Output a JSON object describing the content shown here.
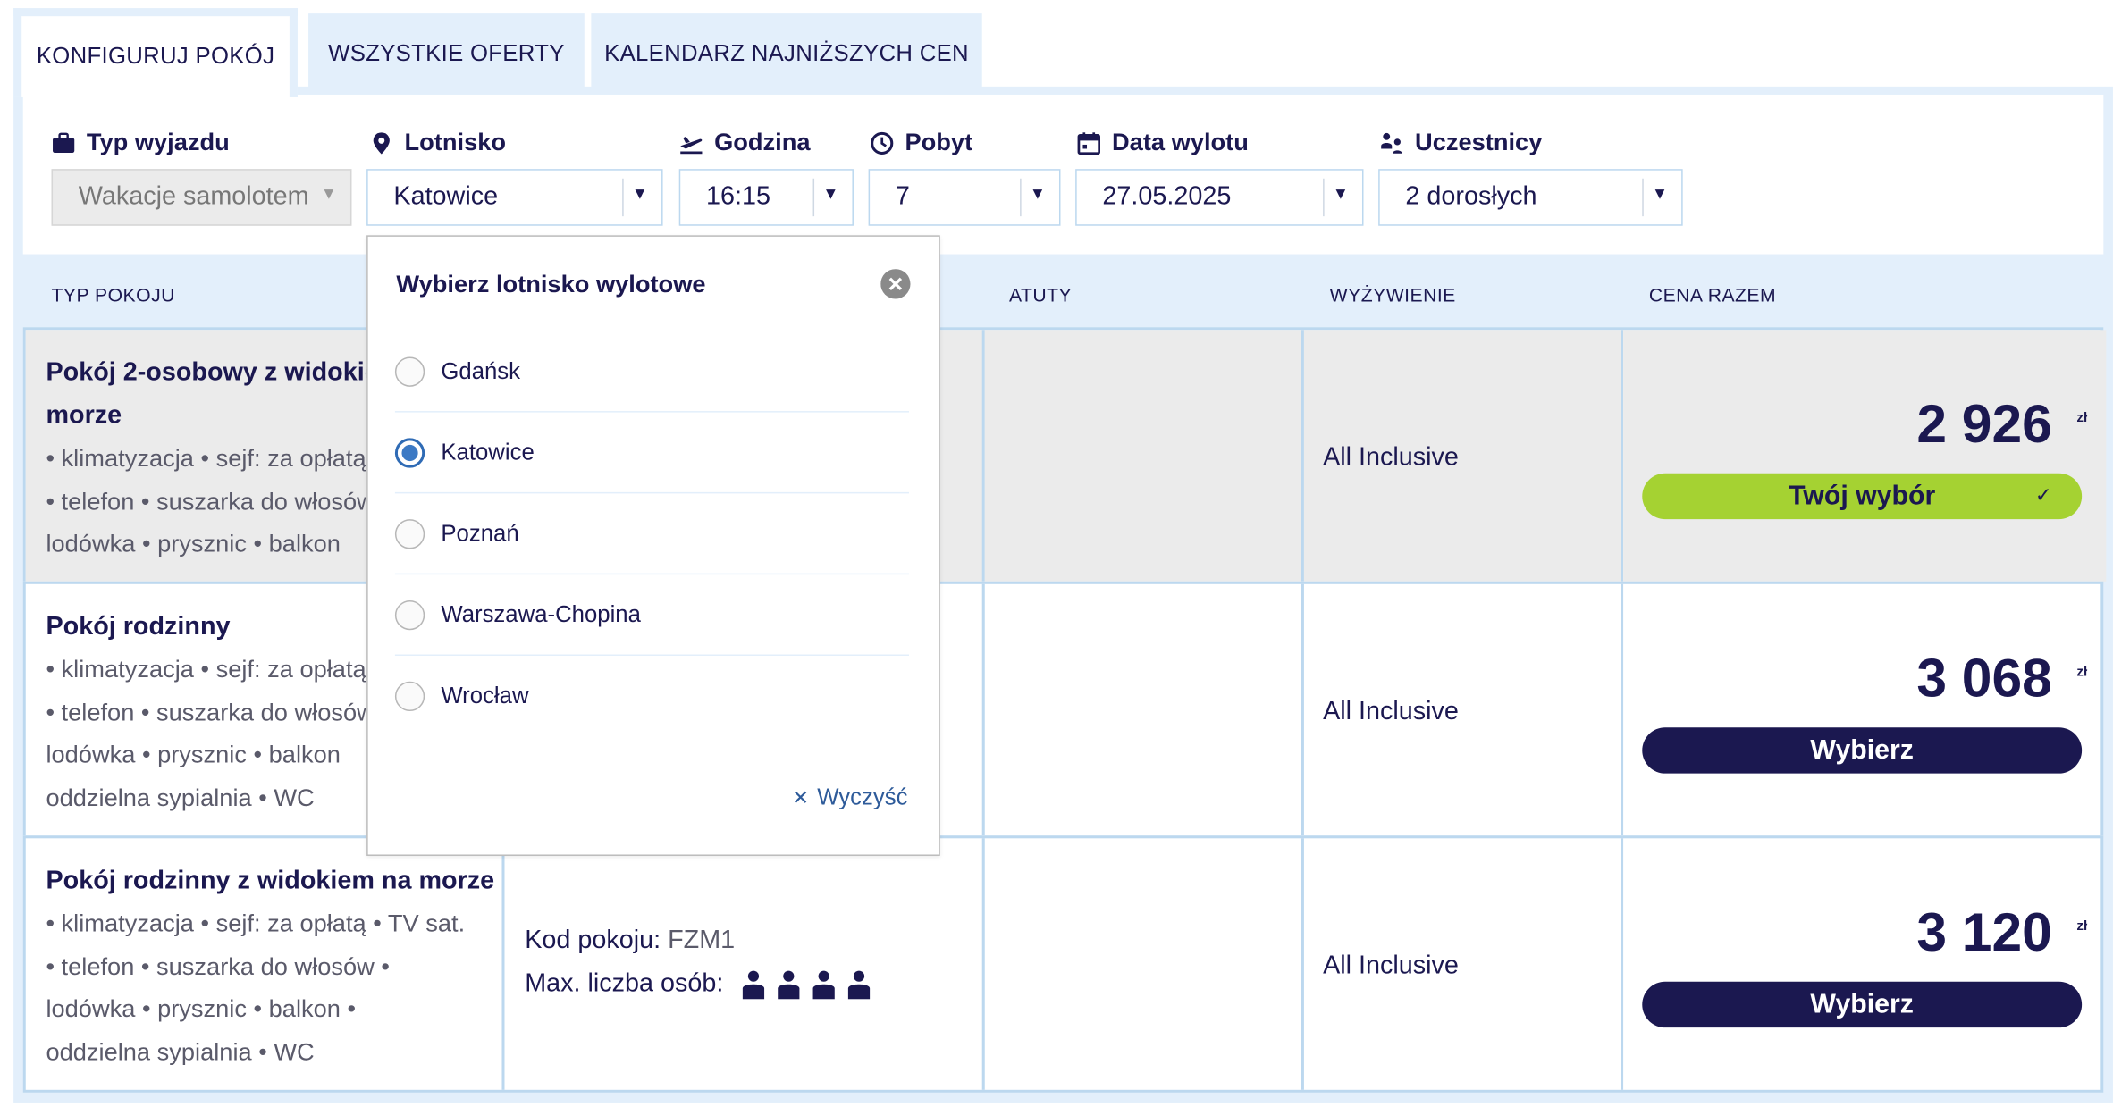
{
  "tabs": [
    {
      "label": "KONFIGURUJ POKÓJ",
      "active": true
    },
    {
      "label": "WSZYSTKIE OFERTY",
      "active": false
    },
    {
      "label": "KALENDARZ NAJNIŻSZYCH CEN",
      "active": false
    }
  ],
  "filters": {
    "trip_type": {
      "label": "Typ wyjazdu",
      "value": "Wakacje samolotem",
      "icon": "suitcase-icon"
    },
    "airport": {
      "label": "Lotnisko",
      "value": "Katowice",
      "icon": "location-pin-icon"
    },
    "time": {
      "label": "Godzina",
      "value": "16:15",
      "icon": "plane-departure-icon"
    },
    "stay": {
      "label": "Pobyt",
      "value": "7",
      "icon": "clock-icon"
    },
    "date": {
      "label": "Data wylotu",
      "value": "27.05.2025",
      "icon": "calendar-icon"
    },
    "participants": {
      "label": "Uczestnicy",
      "value": "2 dorosłych",
      "icon": "people-icon"
    }
  },
  "table": {
    "headers": {
      "room_type": "TYP POKOJU",
      "features": "ATUTY",
      "meals": "WYŻYWIENIE",
      "total_price": "CENA RAZEM"
    }
  },
  "rooms": [
    {
      "title_line1": "Pokój 2-osobowy z widokiem na",
      "title_line2": "morze",
      "features": [
        "• klimatyzacja • sejf: za opłatą • TV sat.",
        "• telefon • suszarka do włosów •",
        "lodówka • prysznic • balkon"
      ],
      "meal": "All Inclusive",
      "price": "2 926",
      "currency": "zł",
      "button": "Twój wybór",
      "selected": true
    },
    {
      "title_line1": "Pokój rodzinny",
      "features": [
        "• klimatyzacja • sejf: za opłatą • TV sat.",
        "• telefon • suszarka do włosów •",
        "lodówka • prysznic • balkon",
        "oddzielna sypialnia • WC"
      ],
      "meal": "All Inclusive",
      "price": "3 068",
      "currency": "zł",
      "button": "Wybierz",
      "selected": false
    },
    {
      "title_line1": "Pokój rodzinny z widokiem na morze",
      "features": [
        "• klimatyzacja • sejf: za opłatą • TV sat.",
        "• telefon • suszarka do włosów •",
        "lodówka • prysznic • balkon •",
        "oddzielna sypialnia • WC"
      ],
      "room_code_label": "Kod pokoju:",
      "room_code": "FZM1",
      "max_persons_label": "Max. liczba osób:",
      "max_persons": 4,
      "meal": "All Inclusive",
      "price": "3 120",
      "currency": "zł",
      "button": "Wybierz",
      "selected": false
    }
  ],
  "airport_dropdown": {
    "title": "Wybierz lotnisko wylotowe",
    "options": [
      {
        "label": "Gdańsk",
        "selected": false
      },
      {
        "label": "Katowice",
        "selected": true
      },
      {
        "label": "Poznań",
        "selected": false
      },
      {
        "label": "Warszawa-Chopina",
        "selected": false
      },
      {
        "label": "Wrocław",
        "selected": false
      }
    ],
    "clear_label": "Wyczyść"
  },
  "colors": {
    "navy": "#1b1850",
    "panel": "#e3effb",
    "border": "#bcd8ef",
    "lime": "#a5d232",
    "radio": "#3c79c4"
  }
}
